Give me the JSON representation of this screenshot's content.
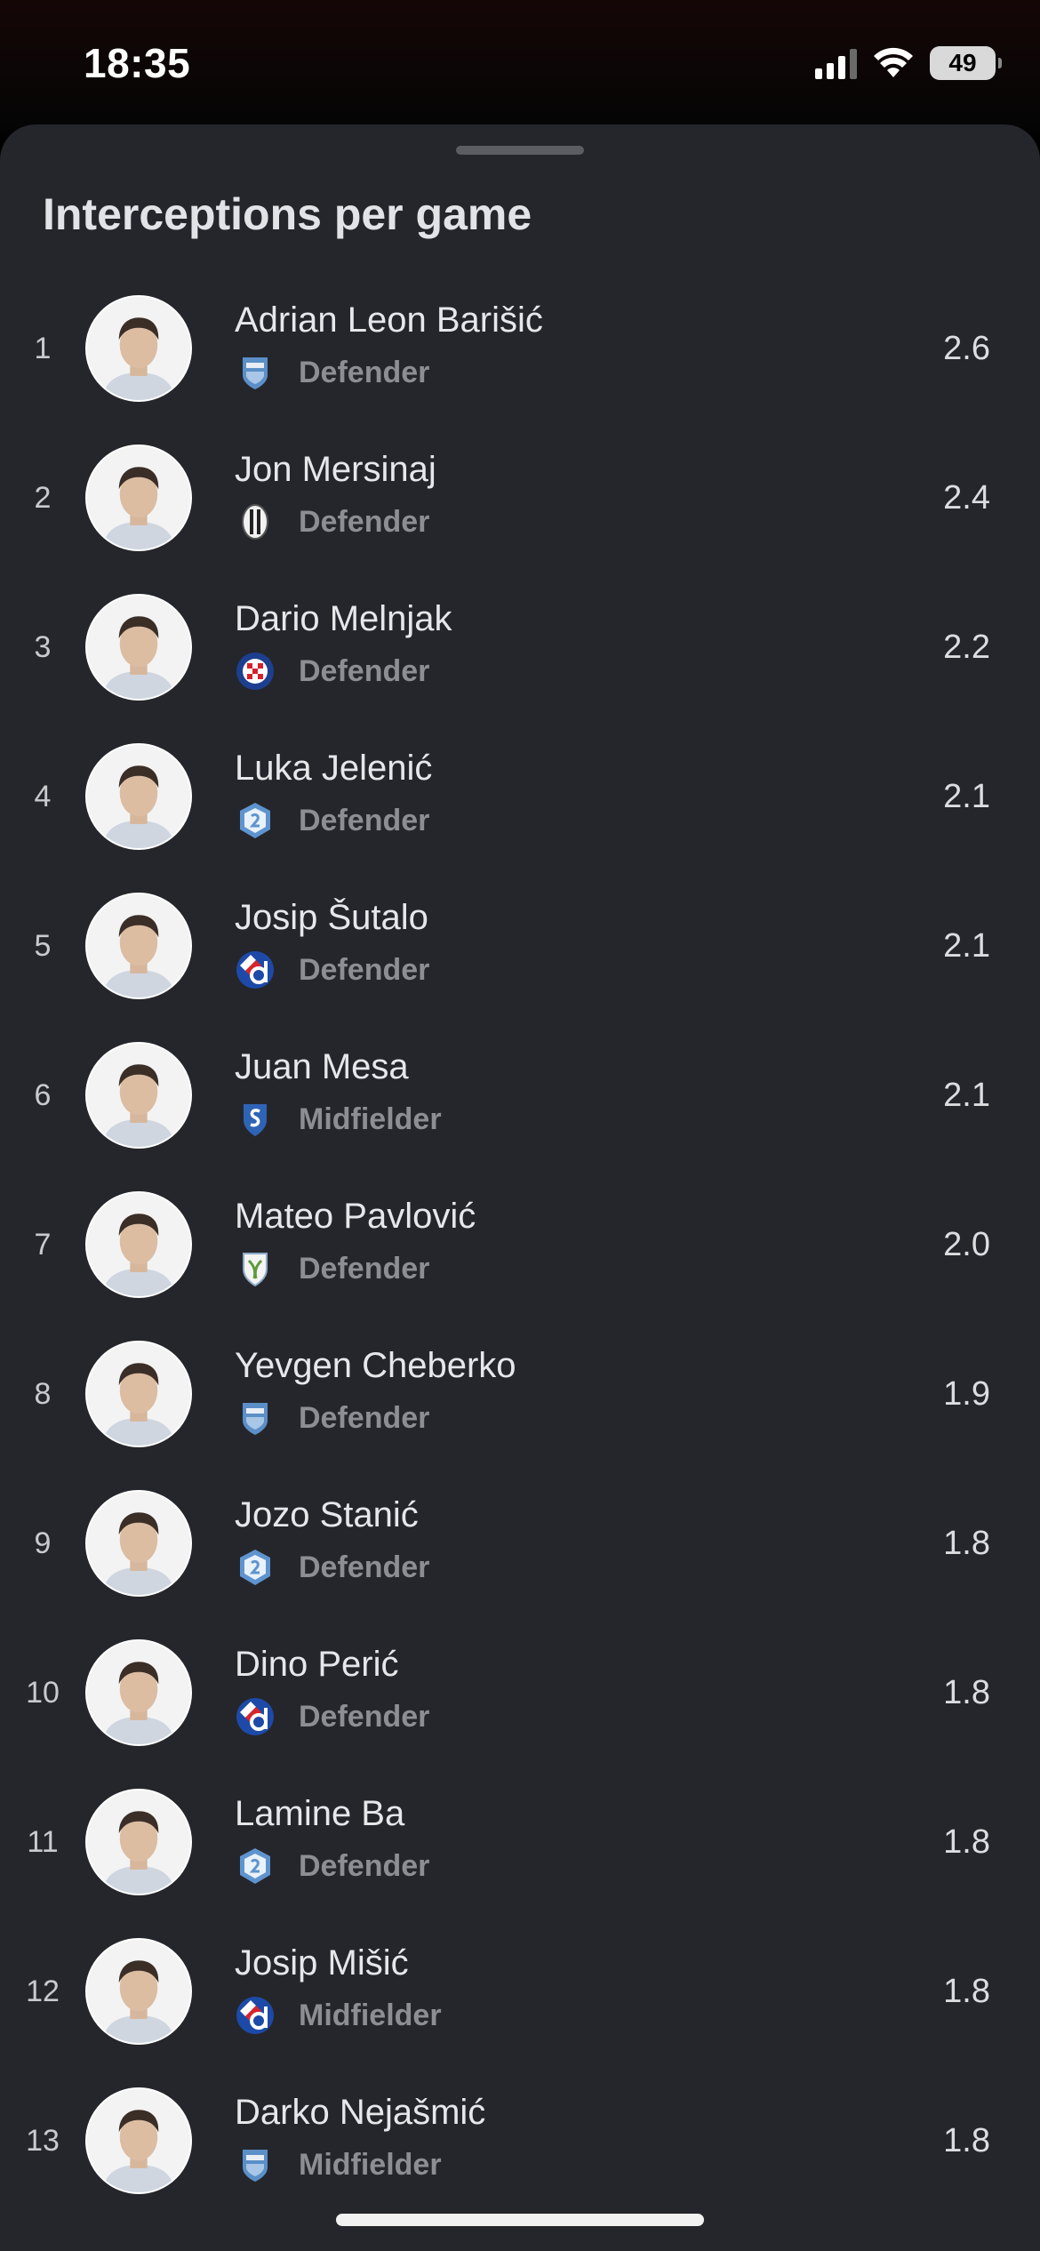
{
  "status_bar": {
    "time": "18:35",
    "battery": "49"
  },
  "sheet": {
    "title": "Interceptions per game"
  },
  "players": [
    {
      "rank": "1",
      "name": "Adrian Leon Barišić",
      "position": "Defender",
      "value": "2.6",
      "team_crest": "shield-crest-light-blue-icon"
    },
    {
      "rank": "2",
      "name": "Jon Mersinaj",
      "position": "Defender",
      "value": "2.4",
      "team_crest": "striped-oval-crest-icon"
    },
    {
      "rank": "3",
      "name": "Dario Melnjak",
      "position": "Defender",
      "value": "2.2",
      "team_crest": "checkered-round-crest-icon"
    },
    {
      "rank": "4",
      "name": "Luka Jelenić",
      "position": "Defender",
      "value": "2.1",
      "team_crest": "hexagon-crest-light-blue-icon"
    },
    {
      "rank": "5",
      "name": "Josip Šutalo",
      "position": "Defender",
      "value": "2.1",
      "team_crest": "checkered-d-crest-icon"
    },
    {
      "rank": "6",
      "name": "Juan Mesa",
      "position": "Midfielder",
      "value": "2.1",
      "team_crest": "shield-s-crest-icon"
    },
    {
      "rank": "7",
      "name": "Mateo Pavlović",
      "position": "Defender",
      "value": "2.0",
      "team_crest": "white-shield-crest-icon"
    },
    {
      "rank": "8",
      "name": "Yevgen Cheberko",
      "position": "Defender",
      "value": "1.9",
      "team_crest": "shield-crest-light-blue-icon"
    },
    {
      "rank": "9",
      "name": "Jozo Stanić",
      "position": "Defender",
      "value": "1.8",
      "team_crest": "hexagon-crest-light-blue-icon"
    },
    {
      "rank": "10",
      "name": "Dino Perić",
      "position": "Defender",
      "value": "1.8",
      "team_crest": "checkered-d-crest-icon"
    },
    {
      "rank": "11",
      "name": "Lamine Ba",
      "position": "Defender",
      "value": "1.8",
      "team_crest": "hexagon-crest-light-blue-icon"
    },
    {
      "rank": "12",
      "name": "Josip Mišić",
      "position": "Midfielder",
      "value": "1.8",
      "team_crest": "checkered-d-crest-icon"
    },
    {
      "rank": "13",
      "name": "Darko Nejašmić",
      "position": "Midfielder",
      "value": "1.8",
      "team_crest": "shield-crest-light-blue-icon"
    }
  ],
  "colors": {
    "sheet_bg": "#25262b",
    "text_primary": "#e6e7ea",
    "text_secondary": "#8d8e93"
  }
}
